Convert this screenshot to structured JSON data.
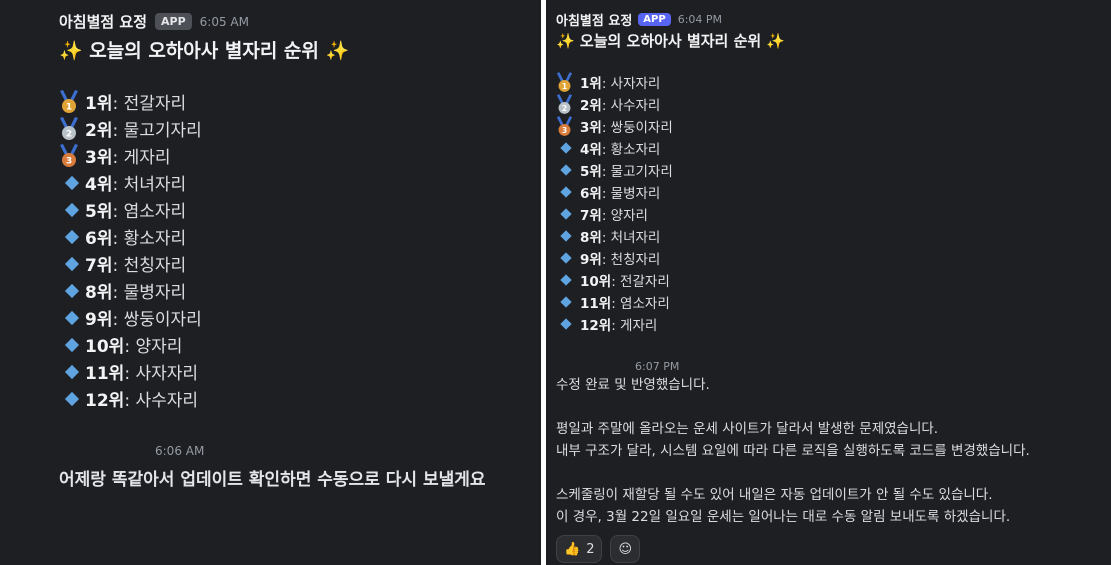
{
  "left": {
    "bot_name": "아침별점 요정",
    "badge": "APP",
    "time": "6:05 AM",
    "title": "✨ 오늘의 오하아사 별자리 순위 ✨",
    "rankings": [
      {
        "icon": "gold-medal",
        "rank": "1위",
        "sign": ": 전갈자리"
      },
      {
        "icon": "silver-medal",
        "rank": "2위",
        "sign": ": 물고기자리"
      },
      {
        "icon": "bronze-medal",
        "rank": "3위",
        "sign": ": 게자리"
      },
      {
        "icon": "diamond",
        "rank": "4위",
        "sign": ": 처녀자리"
      },
      {
        "icon": "diamond",
        "rank": "5위",
        "sign": ": 염소자리"
      },
      {
        "icon": "diamond",
        "rank": "6위",
        "sign": ": 황소자리"
      },
      {
        "icon": "diamond",
        "rank": "7위",
        "sign": ": 천칭자리"
      },
      {
        "icon": "diamond",
        "rank": "8위",
        "sign": ": 물병자리"
      },
      {
        "icon": "diamond",
        "rank": "9위",
        "sign": ": 쌍둥이자리"
      },
      {
        "icon": "diamond",
        "rank": "10위",
        "sign": ": 양자리"
      },
      {
        "icon": "diamond",
        "rank": "11위",
        "sign": ": 사자자리"
      },
      {
        "icon": "diamond",
        "rank": "12위",
        "sign": ": 사수자리"
      }
    ],
    "followup_time": "6:06 AM",
    "followup_text": "어제랑 똑같아서 업데이트 확인하면 수동으로 다시 보낼게요"
  },
  "right": {
    "bot_name": "아침별점 요정",
    "badge": "APP",
    "time": "6:04 PM",
    "title": "✨ 오늘의 오하아사 별자리 순위 ✨",
    "rankings": [
      {
        "icon": "gold-medal",
        "rank": "1위",
        "sign": ": 사자자리"
      },
      {
        "icon": "silver-medal",
        "rank": "2위",
        "sign": ": 사수자리"
      },
      {
        "icon": "bronze-medal",
        "rank": "3위",
        "sign": ": 쌍둥이자리"
      },
      {
        "icon": "diamond",
        "rank": "4위",
        "sign": ": 황소자리"
      },
      {
        "icon": "diamond",
        "rank": "5위",
        "sign": ": 물고기자리"
      },
      {
        "icon": "diamond",
        "rank": "6위",
        "sign": ": 물병자리"
      },
      {
        "icon": "diamond",
        "rank": "7위",
        "sign": ": 양자리"
      },
      {
        "icon": "diamond",
        "rank": "8위",
        "sign": ": 처녀자리"
      },
      {
        "icon": "diamond",
        "rank": "9위",
        "sign": ": 천칭자리"
      },
      {
        "icon": "diamond",
        "rank": "10위",
        "sign": ": 전갈자리"
      },
      {
        "icon": "diamond",
        "rank": "11위",
        "sign": ": 염소자리"
      },
      {
        "icon": "diamond",
        "rank": "12위",
        "sign": ": 게자리"
      }
    ],
    "followup_time": "6:07 PM",
    "lines": [
      "수정 완료 및 반영했습니다.",
      "",
      "평일과 주말에 올라오는 운세 사이트가 달라서 발생한 문제였습니다.",
      "내부 구조가 달라, 시스템 요일에 따라 다른 로직을 실행하도록 코드를 변경했습니다.",
      "",
      "스케줄링이 재할당 될 수도 있어 내일은 자동 업데이트가 안 될 수도 있습니다.",
      "이 경우, 3월 22일 일요일 운세는 일어나는 대로 수동 알림 보내도록 하겠습니다."
    ],
    "reactions": [
      {
        "icon": "thumbs-up-icon",
        "emoji": "👍",
        "count": "2"
      },
      {
        "icon": "add-reaction-icon",
        "emoji": "☺",
        "count": ""
      }
    ]
  },
  "colors": {
    "background": "#1e1f22",
    "badge": "#5865f2",
    "diamond": "#5fa4e0",
    "gold": "#e0a436",
    "silver": "#b9c1c9",
    "bronze": "#d97b3a"
  }
}
